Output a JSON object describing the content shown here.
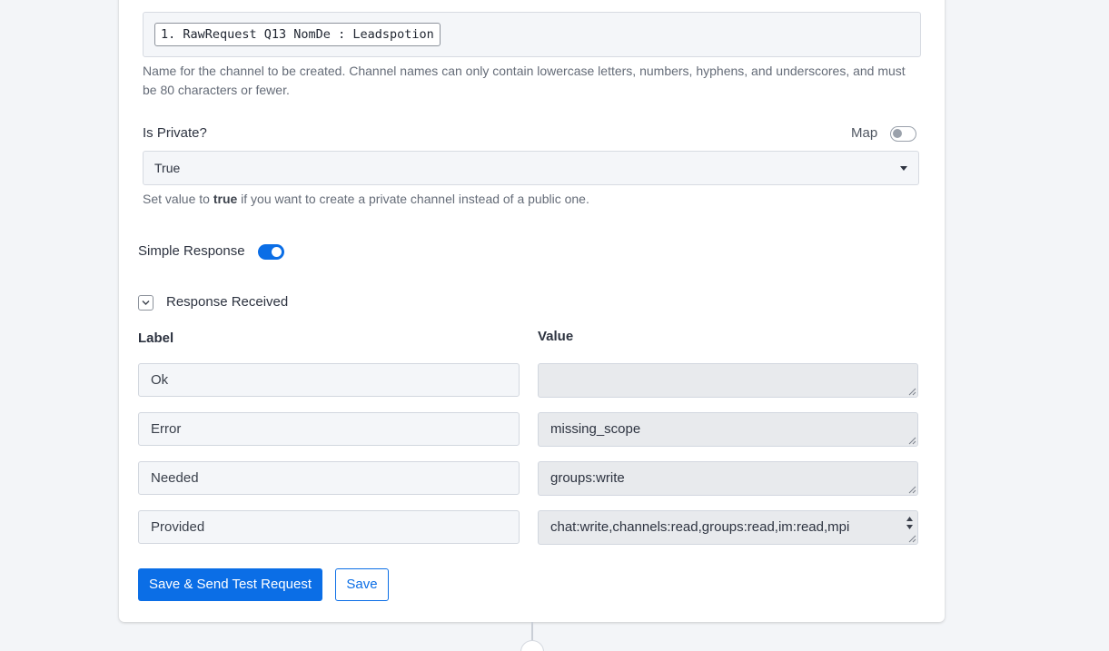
{
  "channel_name": {
    "tag": "1. RawRequest Q13 NomDe : Leadspotion",
    "help": "Name for the channel to be created. Channel names can only contain lowercase letters, numbers, hyphens, and underscores, and must be 80 characters or fewer."
  },
  "is_private": {
    "label": "Is Private?",
    "map_label": "Map",
    "map_toggle_on": false,
    "selected": "True",
    "help_prefix": "Set value to ",
    "help_bold": "true",
    "help_suffix": " if you want to create a private channel instead of a public one."
  },
  "simple_response": {
    "label": "Simple Response",
    "enabled": true
  },
  "response_received": {
    "title": "Response Received",
    "label_header": "Label",
    "value_header": "Value",
    "rows": [
      {
        "label": "Ok",
        "value": ""
      },
      {
        "label": "Error",
        "value": "missing_scope"
      },
      {
        "label": "Needed",
        "value": "groups:write"
      },
      {
        "label": "Provided",
        "value": "chat:write,channels:read,groups:read,im:read,mpi"
      }
    ]
  },
  "actions": {
    "primary": "Save & Send Test Request",
    "secondary": "Save"
  },
  "colors": {
    "accent": "#0b6ee6",
    "background": "#f3f5f8",
    "card": "#ffffff"
  }
}
